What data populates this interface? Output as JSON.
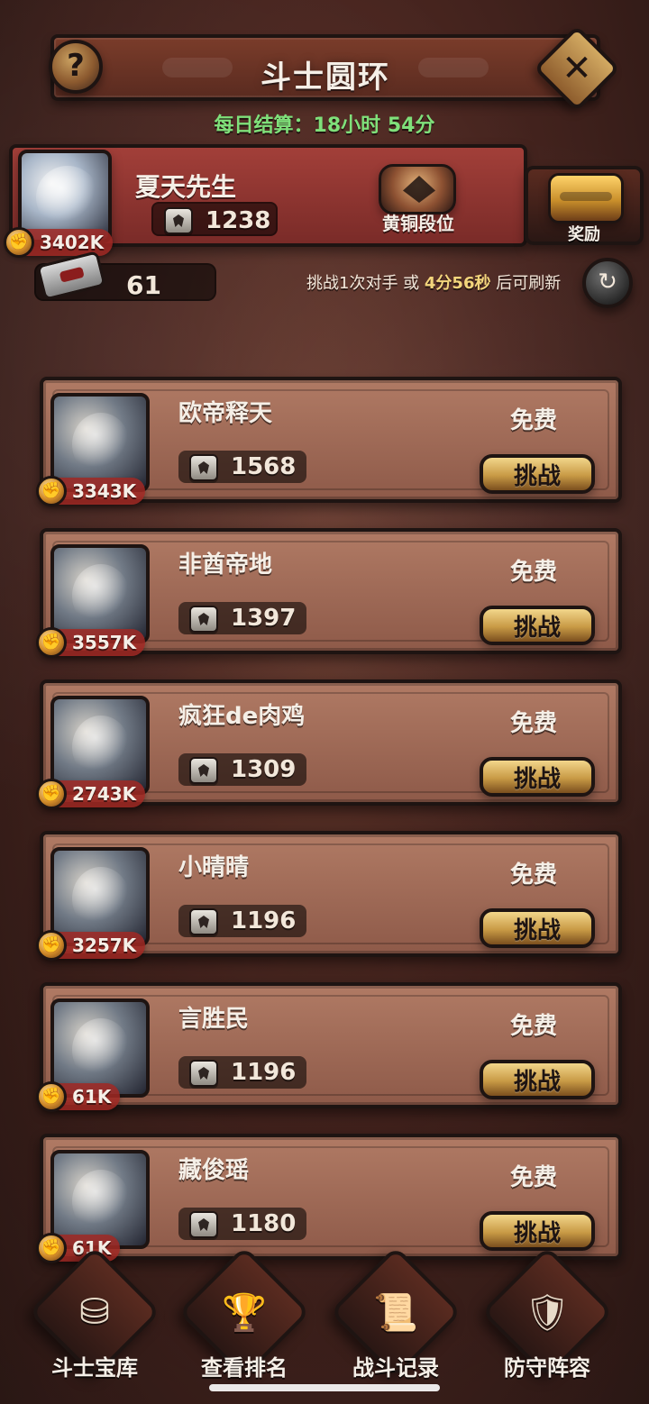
{
  "header": {
    "title": "斗士圆环",
    "help_symbol": "?",
    "close_symbol": "✕",
    "daily_settlement": "每日结算：18小时 54分"
  },
  "player": {
    "name": "夏天先生",
    "score": "1238",
    "power": "3402K",
    "rank": "黄铜段位",
    "reward_label": "奖励"
  },
  "tickets": {
    "count": "61"
  },
  "refresh": {
    "prefix": "挑战1次对手 或 ",
    "time": "4分56秒",
    "suffix": " 后可刷新",
    "icon": "↻"
  },
  "opponents": [
    {
      "name": "欧帝释天",
      "score": "1568",
      "power": "3343K",
      "cost": "免费",
      "action": "挑战"
    },
    {
      "name": "非酋帝地",
      "score": "1397",
      "power": "3557K",
      "cost": "免费",
      "action": "挑战"
    },
    {
      "name": "疯狂de肉鸡",
      "score": "1309",
      "power": "2743K",
      "cost": "免费",
      "action": "挑战"
    },
    {
      "name": "小晴晴",
      "score": "1196",
      "power": "3257K",
      "cost": "免费",
      "action": "挑战"
    },
    {
      "name": "言胜民",
      "score": "1196",
      "power": "61K",
      "cost": "免费",
      "action": "挑战"
    },
    {
      "name": "藏俊瑶",
      "score": "1180",
      "power": "61K",
      "cost": "免费",
      "action": "挑战"
    }
  ],
  "bottom_nav": [
    {
      "label": "斗士宝库",
      "icon": "⛁"
    },
    {
      "label": "查看排名",
      "icon": "🏆"
    },
    {
      "label": "战斗记录",
      "icon": "📜"
    },
    {
      "label": "防守阵容",
      "icon": "🛡"
    }
  ]
}
